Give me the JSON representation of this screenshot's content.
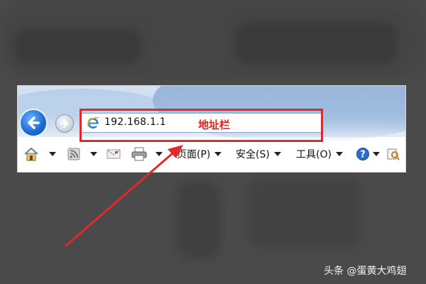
{
  "address_bar": {
    "url": "192.168.1.1",
    "annotation": "地址栏"
  },
  "command_bar": {
    "page_label": "页面(P)",
    "safety_label": "安全(S)",
    "tools_label": "工具(O)"
  },
  "icons": {
    "back": "back-arrow-icon",
    "forward": "forward-arrow-icon",
    "ie": "internet-explorer-icon",
    "home": "home-icon",
    "feeds": "rss-feed-icon",
    "mail": "mail-icon",
    "print": "printer-icon",
    "help": "help-icon",
    "research": "research-icon"
  },
  "colors": {
    "highlight": "#e0282d",
    "annotation_text": "#dd2222",
    "back_button": "#1f6fd6"
  },
  "watermark": "头条 @蛋黄大鸡翅"
}
